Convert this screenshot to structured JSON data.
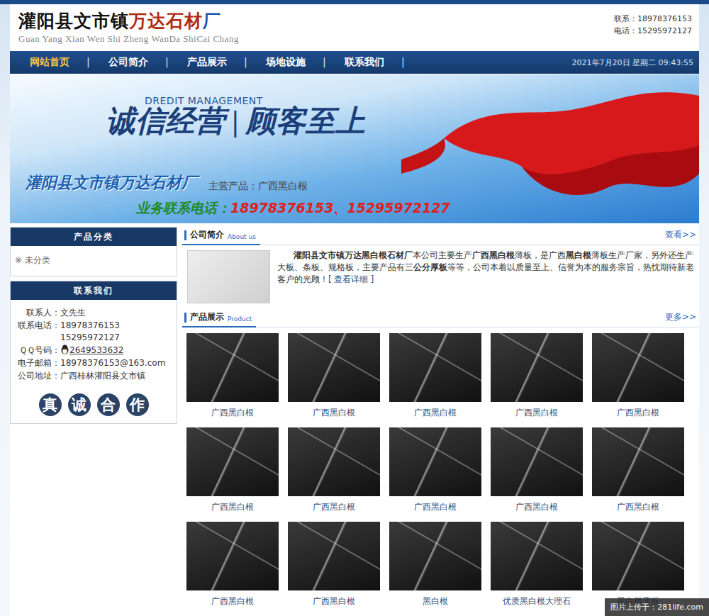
{
  "header": {
    "logo": [
      {
        "text": "灌阳县文市镇",
        "color": "#111111"
      },
      {
        "text": "万达石材",
        "color": "#b02a10"
      },
      {
        "text": "厂",
        "color": "#1a56b0"
      }
    ],
    "pinyin": "Guan Yang Xian Wen Shi Zheng WanDa ShiCai Chang",
    "contacts": [
      "联系：18978376153",
      "电话：15295972127"
    ]
  },
  "nav": {
    "items": [
      {
        "label": "网站首页",
        "selected": true
      },
      {
        "label": "公司简介",
        "selected": false
      },
      {
        "label": "产品展示",
        "selected": false
      },
      {
        "label": "场地设施",
        "selected": false
      },
      {
        "label": "联系我们",
        "selected": false
      }
    ],
    "separator": "|",
    "datetime": "2021年7月20日 星期二 09:43:55"
  },
  "banner": {
    "slogan_en": "DREDIT MANAGEMENT",
    "slogan": "诚信经营 | 顾客至上",
    "company": "灌阳县文市镇万达石材厂",
    "main_products": "主营产品：广西黑白根",
    "phone_label": "业务联系电话：",
    "phones": "18978376153、15295972127"
  },
  "sidebar": {
    "category_title": "产品分类",
    "categories": [
      "※ 未分类"
    ],
    "contact_title": "联系我们",
    "contacts": [
      {
        "label": "联系人：",
        "values": [
          "文先生"
        ],
        "kind": "text"
      },
      {
        "label": "联系电话：",
        "values": [
          "18978376153",
          "15295972127"
        ],
        "kind": "text"
      },
      {
        "label": "ＱＱ号码：",
        "values": [
          "2649533632"
        ],
        "kind": "qq"
      },
      {
        "label": "电子邮箱：",
        "values": [
          "18978376153@163.com"
        ],
        "kind": "text"
      },
      {
        "label": "公司地址：",
        "values": [
          "广西桂林灌阳县文市镇"
        ],
        "kind": "text"
      }
    ],
    "motto": [
      "真",
      "诚",
      "合",
      "作"
    ]
  },
  "about": {
    "title": "公司简介",
    "subtitle": "About us",
    "more": "查看>>",
    "segments": [
      {
        "text": "灌阳县文市镇万达黑白根石材厂",
        "bold": true
      },
      {
        "text": "本公司主要生产",
        "bold": false
      },
      {
        "text": "广西黑白根",
        "bold": true
      },
      {
        "text": "薄板，是广西",
        "bold": false
      },
      {
        "text": "黑白根",
        "bold": true
      },
      {
        "text": "薄板生产厂家，另外还生产大板、条板、规格板，主要产品有三",
        "bold": false
      },
      {
        "text": "公分厚板",
        "bold": true
      },
      {
        "text": "等等，公司本着以质量至上、信誉为本的服务宗旨，热忱期待新老客户的光顾！",
        "bold": false
      }
    ],
    "link": "[ 查看详细 ]"
  },
  "products": {
    "title": "产品展示",
    "subtitle": "Product",
    "more": "更多>>",
    "items": [
      "广西黑白根",
      "广西黑白根",
      "广西黑白根",
      "广西黑白根",
      "广西黑白根",
      "广西黑白根",
      "广西黑白根",
      "广西黑白根",
      "广西黑白根",
      "广西黑白根",
      "广西黑白根",
      "广西黑白根",
      "黑白根",
      "优质黑白根大理石",
      "黑白根薄板"
    ]
  },
  "watermark": "图片上传于：281life.com"
}
